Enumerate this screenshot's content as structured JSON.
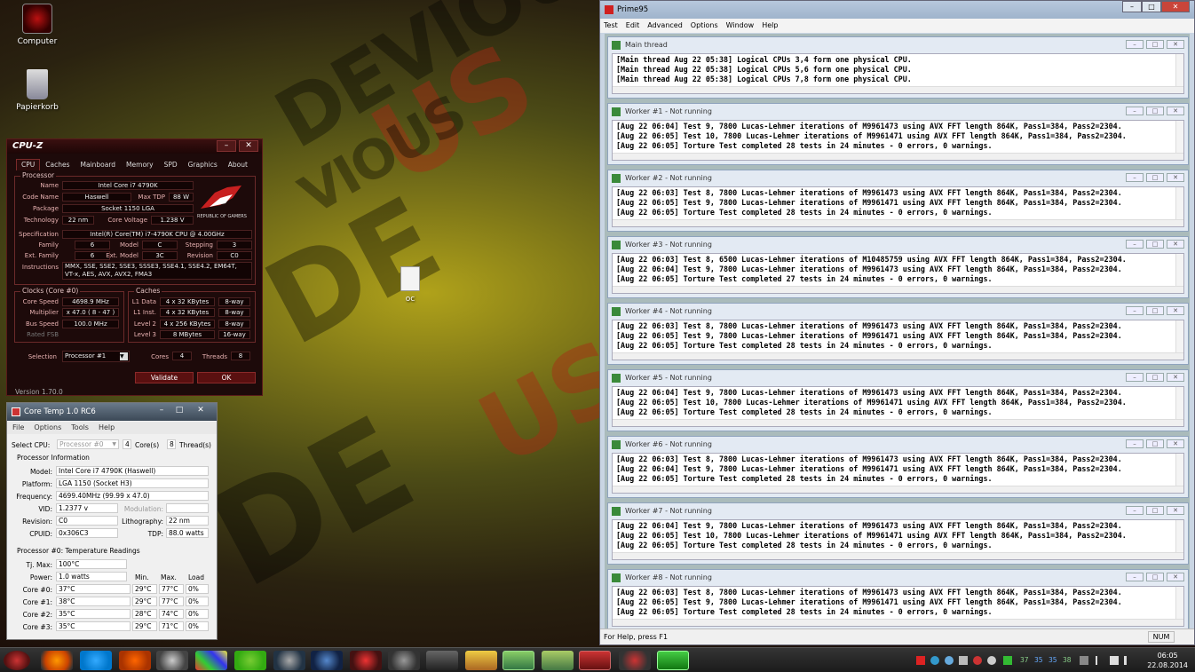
{
  "desktop": {
    "icons": [
      {
        "label": "Computer"
      },
      {
        "label": "Papierkorb"
      },
      {
        "label": "oc"
      }
    ],
    "wallpaper_words": [
      "DEVIOUS",
      "US",
      "DE",
      "VIOUS"
    ]
  },
  "cpuz": {
    "title": "CPU-Z",
    "tabs": [
      "CPU",
      "Caches",
      "Mainboard",
      "Memory",
      "SPD",
      "Graphics",
      "About"
    ],
    "processor": {
      "group_label": "Processor",
      "name_label": "Name",
      "name": "Intel Core i7 4790K",
      "codename_label": "Code Name",
      "codename": "Haswell",
      "maxtdp_label": "Max TDP",
      "maxtdp": "88 W",
      "package_label": "Package",
      "package": "Socket 1150 LGA",
      "technology_label": "Technology",
      "technology": "22 nm",
      "corevoltage_label": "Core Voltage",
      "corevoltage": "1.238 V",
      "spec_label": "Specification",
      "spec": "Intel(R) Core(TM) i7-4790K CPU @ 4.00GHz",
      "family_label": "Family",
      "family": "6",
      "model_label": "Model",
      "model": "C",
      "stepping_label": "Stepping",
      "stepping": "3",
      "extfamily_label": "Ext. Family",
      "extfamily": "6",
      "extmodel_label": "Ext. Model",
      "extmodel": "3C",
      "revision_label": "Revision",
      "revision": "C0",
      "instructions_label": "Instructions",
      "instructions_1": "MMX, SSE, SSE2, SSE3, SSSE3, SSE4.1, SSE4.2, EM64T,",
      "instructions_2": "VT-x, AES, AVX, AVX2, FMA3"
    },
    "clocks": {
      "group_label": "Clocks (Core #0)",
      "corespeed_label": "Core Speed",
      "corespeed": "4698.9 MHz",
      "multiplier_label": "Multiplier",
      "multiplier": "x 47.0 ( 8 - 47 )",
      "busspeed_label": "Bus Speed",
      "busspeed": "100.0 MHz",
      "ratedfsb_label": "Rated FSB",
      "ratedfsb": ""
    },
    "caches": {
      "group_label": "Caches",
      "rows": [
        {
          "label": "L1 Data",
          "size": "4 x 32 KBytes",
          "way": "8-way"
        },
        {
          "label": "L1 Inst.",
          "size": "4 x 32 KBytes",
          "way": "8-way"
        },
        {
          "label": "Level 2",
          "size": "4 x 256 KBytes",
          "way": "8-way"
        },
        {
          "label": "Level 3",
          "size": "8 MBytes",
          "way": "16-way"
        }
      ]
    },
    "selection_label": "Selection",
    "selection": "Processor #1",
    "cores_label": "Cores",
    "cores": "4",
    "threads_label": "Threads",
    "threads": "8",
    "validate_label": "Validate",
    "ok_label": "OK",
    "version": "Version 1.70.0",
    "logo_text": "REPUBLIC OF GAMERS"
  },
  "coretemp": {
    "title": "Core Temp 1.0 RC6",
    "menu": [
      "File",
      "Options",
      "Tools",
      "Help"
    ],
    "selectcpu_label": "Select CPU:",
    "selectcpu": "Processor #0",
    "cores": "4",
    "cores_label": "Core(s)",
    "threads": "8",
    "threads_label": "Thread(s)",
    "procinfo_label": "Processor Information",
    "model_label": "Model:",
    "model": "Intel Core i7 4790K (Haswell)",
    "platform_label": "Platform:",
    "platform": "LGA 1150 (Socket H3)",
    "frequency_label": "Frequency:",
    "frequency": "4699.40MHz (99.99 x 47.0)",
    "vid_label": "VID:",
    "vid": "1.2377 v",
    "modulation_label": "Modulation:",
    "revision_label": "Revision:",
    "revision": "C0",
    "litho_label": "Lithography:",
    "litho": "22 nm",
    "cpuid_label": "CPUID:",
    "cpuid": "0x306C3",
    "tdp_label": "TDP:",
    "tdp": "88.0 watts",
    "temps_label": "Processor #0: Temperature Readings",
    "tjmax_label": "Tj. Max:",
    "tjmax": "100°C",
    "power_label": "Power:",
    "power": "1.0 watts",
    "col_min": "Min.",
    "col_max": "Max.",
    "col_load": "Load",
    "cores_rows": [
      {
        "label": "Core #0:",
        "temp": "37°C",
        "min": "29°C",
        "max": "77°C",
        "load": "0%"
      },
      {
        "label": "Core #1:",
        "temp": "38°C",
        "min": "29°C",
        "max": "77°C",
        "load": "0%"
      },
      {
        "label": "Core #2:",
        "temp": "35°C",
        "min": "28°C",
        "max": "74°C",
        "load": "0%"
      },
      {
        "label": "Core #3:",
        "temp": "35°C",
        "min": "29°C",
        "max": "71°C",
        "load": "0%"
      }
    ]
  },
  "prime95": {
    "title": "Prime95",
    "menu": [
      "Test",
      "Edit",
      "Advanced",
      "Options",
      "Window",
      "Help"
    ],
    "windows": [
      {
        "name": "Main thread",
        "lines": [
          "[Main thread Aug 22 05:38] Logical CPUs 3,4 form one physical CPU.",
          "[Main thread Aug 22 05:38] Logical CPUs 5,6 form one physical CPU.",
          "[Main thread Aug 22 05:38] Logical CPUs 7,8 form one physical CPU."
        ]
      },
      {
        "name": "Worker #1 - Not running",
        "lines": [
          "[Aug 22 06:04] Test 9, 7800 Lucas-Lehmer iterations of M9961473 using AVX FFT length 864K, Pass1=384, Pass2=2304.",
          "[Aug 22 06:05] Test 10, 7800 Lucas-Lehmer iterations of M9961471 using AVX FFT length 864K, Pass1=384, Pass2=2304.",
          "[Aug 22 06:05] Torture Test completed 28 tests in 24 minutes - 0 errors, 0 warnings."
        ]
      },
      {
        "name": "Worker #2 - Not running",
        "lines": [
          "[Aug 22 06:03] Test 8, 7800 Lucas-Lehmer iterations of M9961473 using AVX FFT length 864K, Pass1=384, Pass2=2304.",
          "[Aug 22 06:05] Test 9, 7800 Lucas-Lehmer iterations of M9961471 using AVX FFT length 864K, Pass1=384, Pass2=2304.",
          "[Aug 22 06:05] Torture Test completed 28 tests in 24 minutes - 0 errors, 0 warnings."
        ]
      },
      {
        "name": "Worker #3 - Not running",
        "lines": [
          "[Aug 22 06:03] Test 8, 6500 Lucas-Lehmer iterations of M10485759 using AVX FFT length 864K, Pass1=384, Pass2=2304.",
          "[Aug 22 06:04] Test 9, 7800 Lucas-Lehmer iterations of M9961473 using AVX FFT length 864K, Pass1=384, Pass2=2304.",
          "[Aug 22 06:05] Torture Test completed 27 tests in 24 minutes - 0 errors, 0 warnings."
        ]
      },
      {
        "name": "Worker #4 - Not running",
        "lines": [
          "[Aug 22 06:03] Test 8, 7800 Lucas-Lehmer iterations of M9961473 using AVX FFT length 864K, Pass1=384, Pass2=2304.",
          "[Aug 22 06:05] Test 9, 7800 Lucas-Lehmer iterations of M9961471 using AVX FFT length 864K, Pass1=384, Pass2=2304.",
          "[Aug 22 06:05] Torture Test completed 28 tests in 24 minutes - 0 errors, 0 warnings."
        ]
      },
      {
        "name": "Worker #5 - Not running",
        "lines": [
          "[Aug 22 06:04] Test 9, 7800 Lucas-Lehmer iterations of M9961473 using AVX FFT length 864K, Pass1=384, Pass2=2304.",
          "[Aug 22 06:05] Test 10, 7800 Lucas-Lehmer iterations of M9961471 using AVX FFT length 864K, Pass1=384, Pass2=2304.",
          "[Aug 22 06:05] Torture Test completed 28 tests in 24 minutes - 0 errors, 0 warnings."
        ]
      },
      {
        "name": "Worker #6 - Not running",
        "lines": [
          "[Aug 22 06:03] Test 8, 7800 Lucas-Lehmer iterations of M9961473 using AVX FFT length 864K, Pass1=384, Pass2=2304.",
          "[Aug 22 06:04] Test 9, 7800 Lucas-Lehmer iterations of M9961471 using AVX FFT length 864K, Pass1=384, Pass2=2304.",
          "[Aug 22 06:05] Torture Test completed 28 tests in 24 minutes - 0 errors, 0 warnings."
        ]
      },
      {
        "name": "Worker #7 - Not running",
        "lines": [
          "[Aug 22 06:04] Test 9, 7800 Lucas-Lehmer iterations of M9961473 using AVX FFT length 864K, Pass1=384, Pass2=2304.",
          "[Aug 22 06:05] Test 10, 7800 Lucas-Lehmer iterations of M9961471 using AVX FFT length 864K, Pass1=384, Pass2=2304.",
          "[Aug 22 06:05] Torture Test completed 28 tests in 24 minutes - 0 errors, 0 warnings."
        ]
      },
      {
        "name": "Worker #8 - Not running",
        "lines": [
          "[Aug 22 06:03] Test 8, 7800 Lucas-Lehmer iterations of M9961473 using AVX FFT length 864K, Pass1=384, Pass2=2304.",
          "[Aug 22 06:05] Test 9, 7800 Lucas-Lehmer iterations of M9961471 using AVX FFT length 864K, Pass1=384, Pass2=2304.",
          "[Aug 22 06:05] Torture Test completed 28 tests in 24 minutes - 0 errors, 0 warnings."
        ]
      }
    ],
    "status_help": "For Help, press F1",
    "status_num": "NUM"
  },
  "taskbar": {
    "apps": [
      "start-orb",
      "firefox",
      "skype",
      "unknown-app",
      "winamp",
      "color-app",
      "spotify",
      "steam",
      "tool-app",
      "speed-app",
      "x-app",
      "evga-app",
      "hwinfo-app",
      "notes-app",
      "folder-app",
      "cpuz-app",
      "rog-app",
      "prime-app"
    ],
    "tray_temps": [
      "37",
      "35",
      "35",
      "38"
    ],
    "time": "06:05",
    "date": "22.08.2014"
  },
  "colors": {
    "cpuz_bg": "#1d0a0a",
    "prime_title": "#b7c8dc",
    "taskbar": "#1b1b1b"
  }
}
